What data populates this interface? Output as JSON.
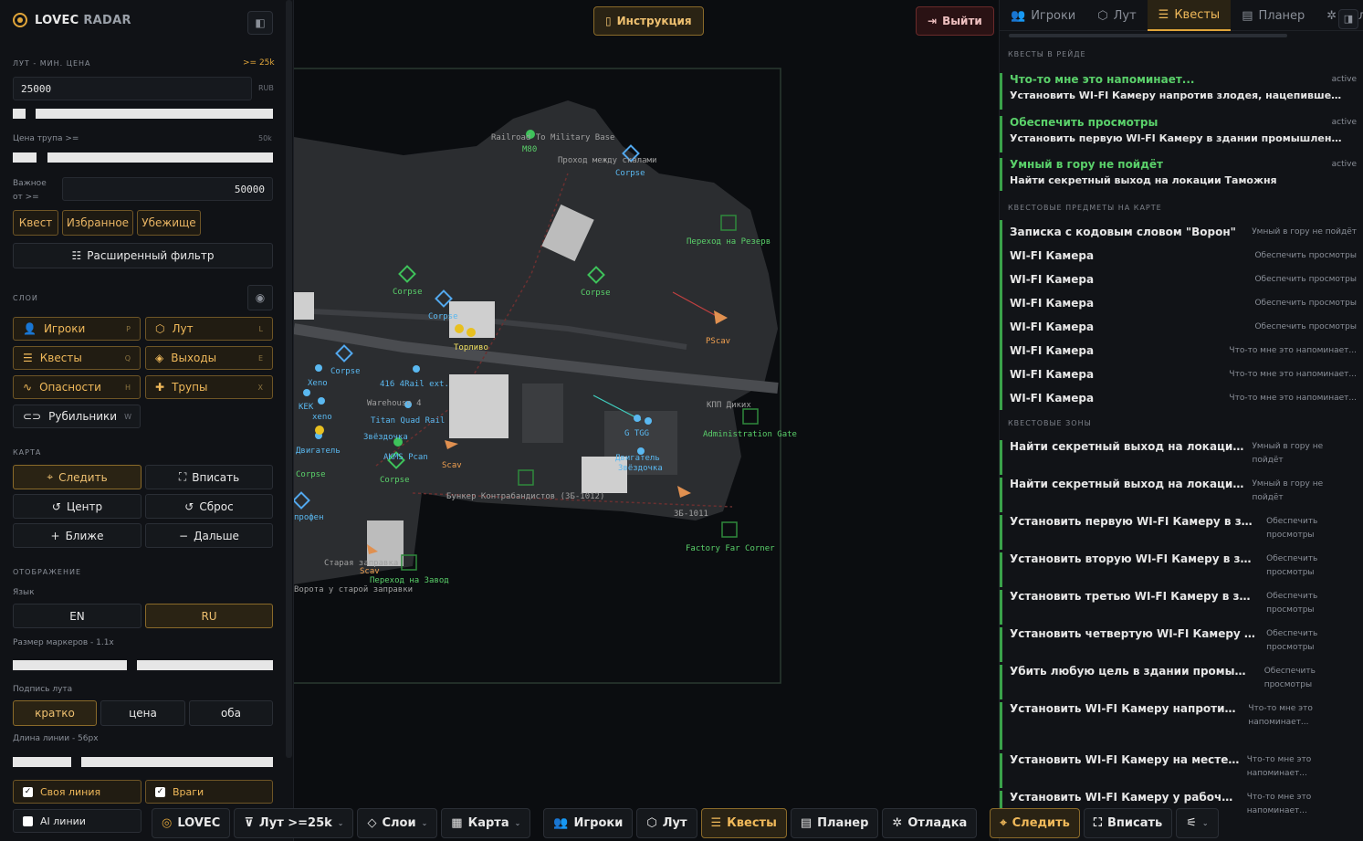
{
  "app": {
    "brand_a": "LOVEC",
    "brand_b": "RADAR",
    "collapse_icon": "panel-collapse-icon"
  },
  "loot": {
    "section": "ЛУТ - МИН. ЦЕНА",
    "badge": ">= 25k",
    "value": "25000",
    "unit": "RUB",
    "corpse_label": "Цена трупа >=",
    "corpse_hint": "50k",
    "important_label": "Важное от >=",
    "important_value": "50000"
  },
  "filters": [
    "Квест",
    "Избранное",
    "Убежище"
  ],
  "advanced": "Расширенный фильтр",
  "layers": {
    "section": "СЛОИ",
    "items": [
      {
        "label": "Игроки",
        "key": "P",
        "on": true
      },
      {
        "label": "Лут",
        "key": "L",
        "on": true
      },
      {
        "label": "Квесты",
        "key": "Q",
        "on": true
      },
      {
        "label": "Выходы",
        "key": "E",
        "on": true
      },
      {
        "label": "Опасности",
        "key": "H",
        "on": true
      },
      {
        "label": "Трупы",
        "key": "X",
        "on": true
      },
      {
        "label": "Рубильники",
        "key": "W",
        "on": false
      }
    ]
  },
  "mapctl": {
    "section": "КАРТА",
    "follow": "Следить",
    "fit": "Вписать",
    "center": "Центр",
    "reset": "Сброс",
    "closer": "Ближе",
    "further": "Дальше"
  },
  "display": {
    "section": "ОТОБРАЖЕНИЕ",
    "lang_label": "Язык",
    "lang_en": "EN",
    "lang_ru": "RU",
    "marker_size": "Размер маркеров - 1.1x",
    "loot_caption": "Подпись лута",
    "cap_short": "кратко",
    "cap_price": "цена",
    "cap_both": "оба",
    "line_len": "Длина линии - 56px",
    "own_line": "Своя линия",
    "enemies": "Враги",
    "ai_lines": "AI линии"
  },
  "map": {
    "instr": "Инструкция",
    "exit": "Выйти",
    "labels": [
      "Railroad To Military Base",
      "M80",
      "Проход между скалами",
      "Corpse",
      "Переход на Резерв",
      "Corpse",
      "Corpse",
      "Corpse",
      "PScav",
      "Topливо",
      "416 4Rail ext.",
      "Corpse",
      "Xeno",
      "KEK",
      "xeno",
      "Warehouse 4",
      "Titan Quad Rail",
      "Звёздочка",
      "AKMS Pcan",
      "Corpse",
      "Двигатель",
      "Corpse",
      "Scav",
      "КПП Диких",
      "Administration Gate",
      "G TGG",
      "Двигатель",
      "Звёздочка",
      "Бункер Контрабандистов (ЗБ-1012)",
      "ЗБ-1011",
      "Factory Far Corner",
      "профен",
      "Старая заправка",
      "Scav",
      "Переход на Завод",
      "Ворота у старой заправки"
    ]
  },
  "right": {
    "tabs": [
      "Игроки",
      "Лут",
      "Квесты",
      "Планер",
      "Отладка"
    ],
    "sec_raid": "КВЕСТЫ В РЕЙДЕ",
    "quests": [
      {
        "title": "Что-то мне это напоминает...",
        "status": "active",
        "desc": "Установить WI-FI Камеру напротив злодея, нацепившего неоправданный..."
      },
      {
        "title": "Обеспечить просмотры",
        "status": "active",
        "desc": "Установить первую WI-FI Камеру в здании промышленного корпуса..."
      },
      {
        "title": "Умный в гору не пойдёт",
        "status": "active",
        "desc": "Найти секретный выход на локации Таможня"
      }
    ],
    "sec_items": "КВЕСТОВЫЕ ПРЕДМЕТЫ НА КАРТЕ",
    "items": [
      {
        "name": "Записка с кодовым словом \"Ворон\"",
        "quest": "Умный в гору не пойдёт"
      },
      {
        "name": "WI-FI Камера",
        "quest": "Обеспечить просмотры"
      },
      {
        "name": "WI-FI Камера",
        "quest": "Обеспечить просмотры"
      },
      {
        "name": "WI-FI Камера",
        "quest": "Обеспечить просмотры"
      },
      {
        "name": "WI-FI Камера",
        "quest": "Обеспечить просмотры"
      },
      {
        "name": "WI-FI Камера",
        "quest": "Что-то мне это напоминает..."
      },
      {
        "name": "WI-FI Камера",
        "quest": "Что-то мне это напоминает..."
      },
      {
        "name": "WI-FI Камера",
        "quest": "Что-то мне это напоминает..."
      }
    ],
    "sec_zones": "КВЕСТОВЫЕ ЗОНЫ",
    "zones": [
      {
        "name": "Найти секретный выход на локации Там...",
        "quest": "Умный в гору не пойдёт"
      },
      {
        "name": "Найти секретный выход на локации Там...",
        "quest": "Умный в гору не пойдёт"
      },
      {
        "name": "Установить первую WI-FI Камеру в здании пром...",
        "quest": "Обеспечить просмотры"
      },
      {
        "name": "Установить вторую WI-FI Камеру в здании промы...",
        "quest": "Обеспечить просмотры"
      },
      {
        "name": "Установить третью WI-FI Камеру в здании промы...",
        "quest": "Обеспечить просмотры"
      },
      {
        "name": "Установить четвертую WI-FI Камеру в здании про...",
        "quest": "Обеспечить просмотры"
      },
      {
        "name": "Убить любую цель в здании промышленного ко...",
        "quest": "Обеспечить просмотры"
      },
      {
        "name": "Установить WI-FI Камеру напротив злодея, нац...",
        "quest": "Что-то мне это напоминает..."
      },
      {
        "name": "Установить WI-FI Камеру на месте казни член...",
        "quest": "Что-то мне это напоминает..."
      },
      {
        "name": "Установить WI-FI Камеру у рабочего места ин...",
        "quest": "Что-то мне это напоминает..."
      }
    ]
  },
  "bottom": {
    "lovec": "LOVEC",
    "loot": "Лут >=25k",
    "layers": "Слои",
    "map": "Карта",
    "players": "Игроки",
    "lootb": "Лут",
    "quests": "Квесты",
    "planner": "Планер",
    "debug": "Отладка",
    "follow": "Следить",
    "fit": "Вписать"
  }
}
